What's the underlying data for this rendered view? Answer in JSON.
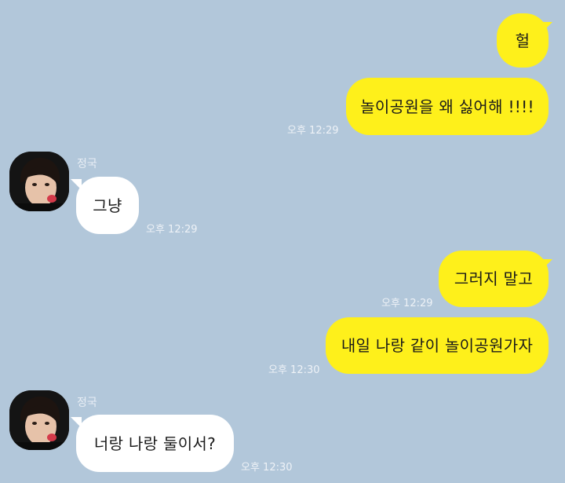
{
  "chat": {
    "messages": [
      {
        "text": "헐",
        "time": ""
      },
      {
        "text": "놀이공원을 왜 싫어해 !!!!",
        "time": "오후 12:29"
      },
      {
        "sender": "정국",
        "text": "그냥",
        "time": "오후 12:29"
      },
      {
        "text": "그러지 말고",
        "time": "오후 12:29"
      },
      {
        "text": "내일 나랑 같이 놀이공원가자",
        "time": "오후 12:30"
      },
      {
        "sender": "정국",
        "text": "너랑 나랑 둘이서?",
        "time": "오후 12:30"
      }
    ]
  },
  "colors": {
    "background": "#b2c7da",
    "my_bubble": "#fef01b",
    "their_bubble": "#ffffff"
  },
  "icons": {
    "avatar": "profile-photo"
  }
}
